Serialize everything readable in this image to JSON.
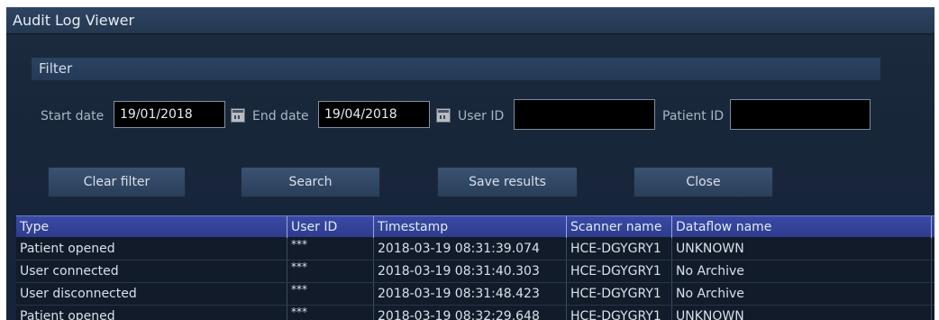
{
  "window": {
    "title": "Audit Log Viewer"
  },
  "filter": {
    "header": "Filter",
    "start_date_label": "Start date",
    "start_date_value": "19/01/2018",
    "end_date_label": "End date",
    "end_date_value": "19/04/2018",
    "user_id_label": "User ID",
    "user_id_value": "",
    "patient_id_label": "Patient ID",
    "patient_id_value": ""
  },
  "buttons": {
    "clear_filter": "Clear filter",
    "search": "Search",
    "save_results": "Save results",
    "close": "Close"
  },
  "table": {
    "columns": [
      "Type",
      "User ID",
      "Timestamp",
      "Scanner name",
      "Dataflow name"
    ],
    "rows": [
      [
        "Patient opened",
        "***",
        "2018-03-19 08:31:39.074",
        "HCE-DGYGRY1",
        "UNKNOWN"
      ],
      [
        "User connected",
        "***",
        "2018-03-19 08:31:40.303",
        "HCE-DGYGRY1",
        "No Archive"
      ],
      [
        "User disconnected",
        "***",
        "2018-03-19 08:31:48.423",
        "HCE-DGYGRY1",
        "No Archive"
      ],
      [
        "Patient opened",
        "***",
        "2018-03-19 08:32:29.648",
        "HCE-DGYGRY1",
        "UNKNOWN"
      ]
    ]
  },
  "icons": {
    "calendar": "calendar-icon"
  },
  "colors": {
    "background": "#18263a",
    "header_bar": "#2e4463",
    "table_header": "#3a4aa6",
    "input_bg": "#000000"
  }
}
